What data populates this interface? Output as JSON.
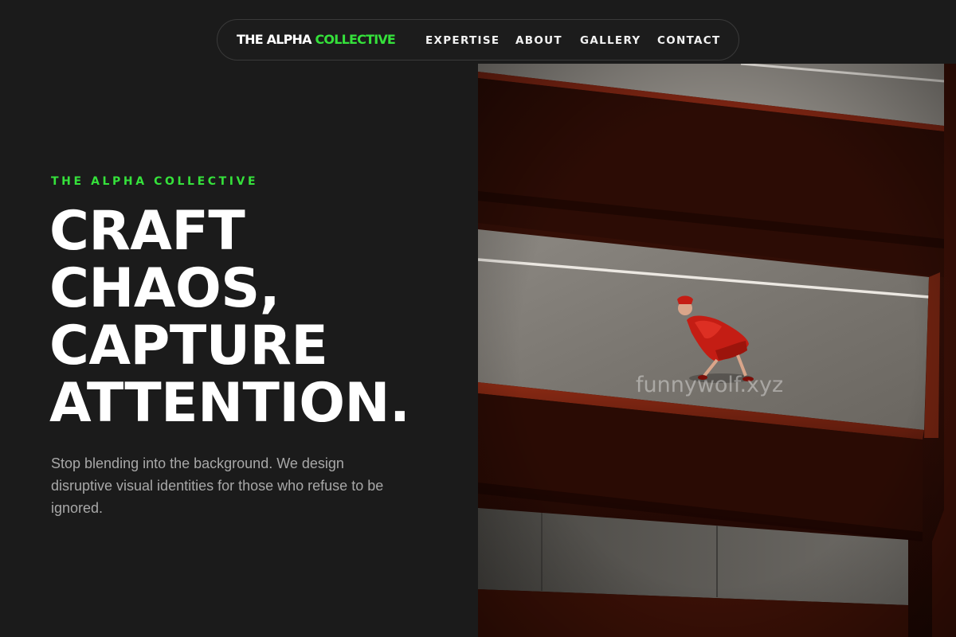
{
  "nav": {
    "brand_first": "THE ALPHA ",
    "brand_accent": "COLLECTIVE",
    "links": [
      "EXPERTISE",
      "ABOUT",
      "GALLERY",
      "CONTACT"
    ]
  },
  "hero": {
    "eyebrow": "THE ALPHA COLLECTIVE",
    "headline_lines": [
      "CRAFT",
      "CHAOS,",
      "CAPTURE",
      "ATTENTION."
    ],
    "description": "Stop blending into the background. We design disruptive visual identities for those who refuse to be ignored."
  },
  "photo": {
    "watermark": "funnywolf.xyz",
    "subject": "person in red coat walking on parking garage ramp"
  },
  "colors": {
    "background": "#1b1b1b",
    "accent": "#35e13b",
    "text": "#ffffff",
    "muted_text": "#a8a8a8"
  }
}
